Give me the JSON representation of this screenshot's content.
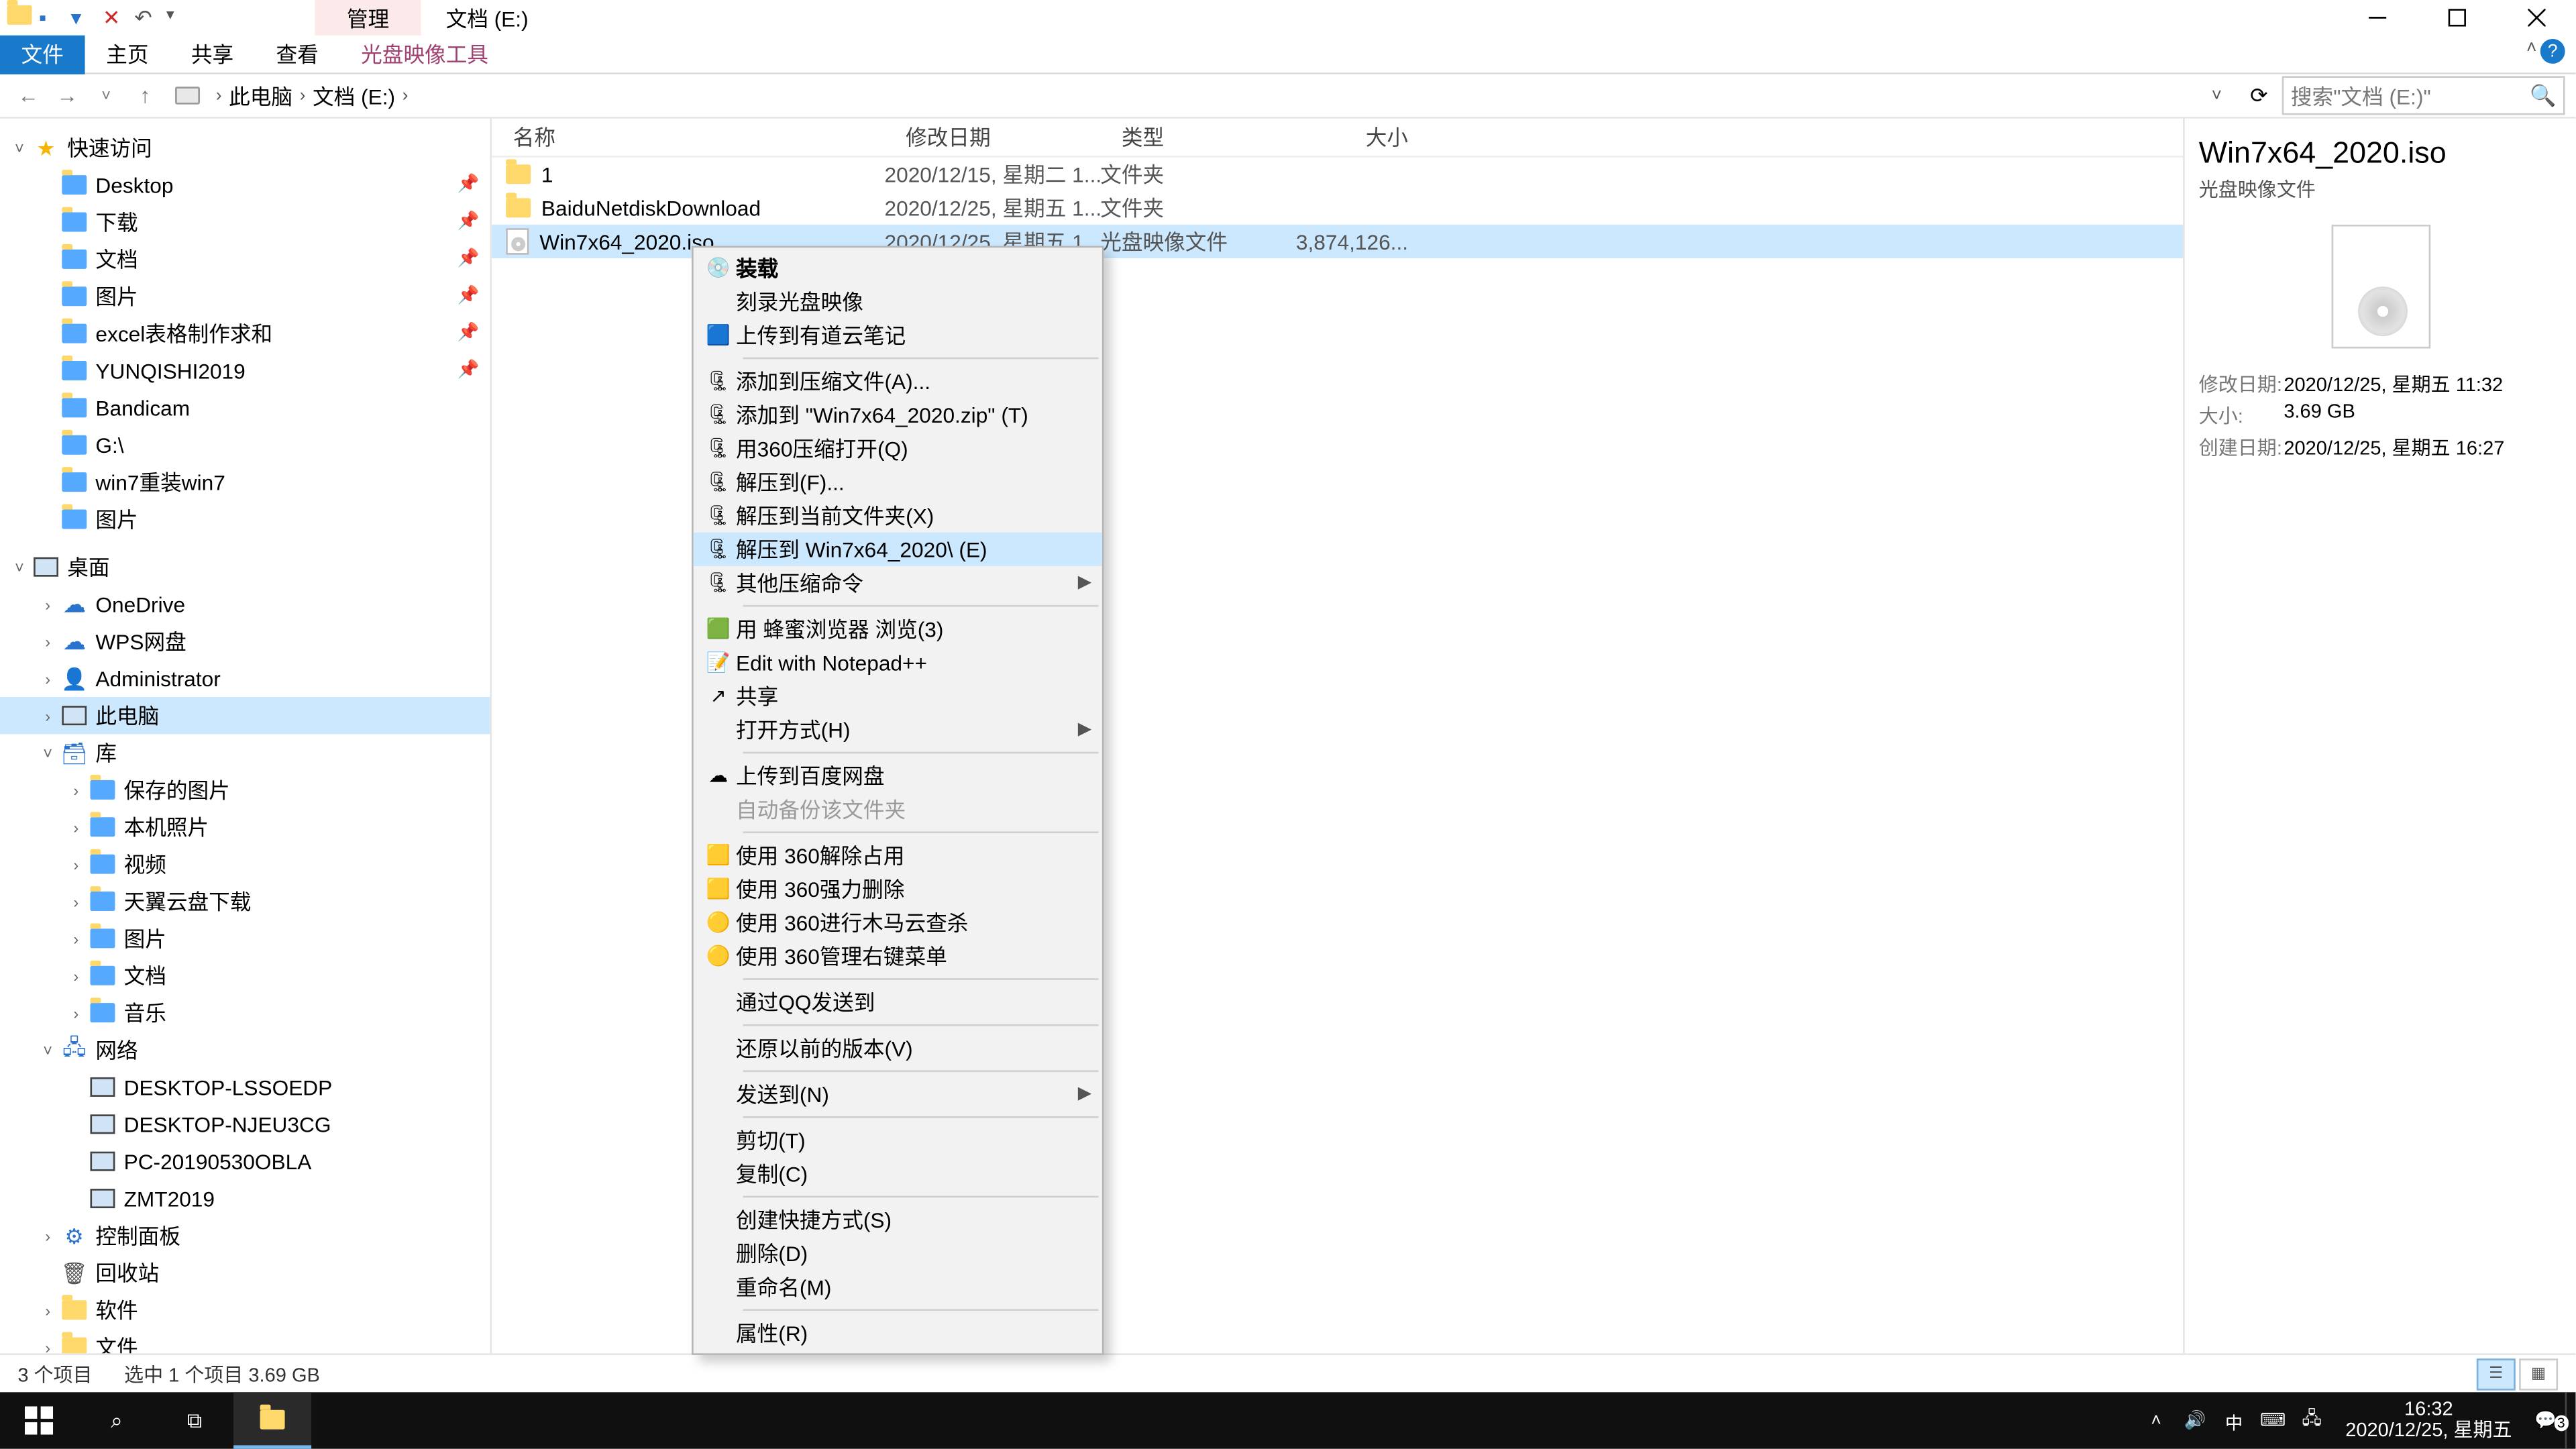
{
  "title_bar": {
    "manage_tab": "管理",
    "window_title": "文档 (E:)"
  },
  "ribbon": {
    "file": "文件",
    "home": "主页",
    "share": "共享",
    "view": "查看",
    "disc_tools": "光盘映像工具"
  },
  "address": {
    "root": "此电脑",
    "folder": "文档 (E:)"
  },
  "search": {
    "placeholder": "搜索\"文档 (E:)\""
  },
  "nav": {
    "quick": "快速访问",
    "items_q": [
      "Desktop",
      "下载",
      "文档",
      "图片",
      "excel表格制作求和",
      "YUNQISHI2019",
      "Bandicam",
      "G:\\",
      "win7重装win7",
      "图片"
    ],
    "desktop": "桌面",
    "onedrive": "OneDrive",
    "wps": "WPS网盘",
    "admin": "Administrator",
    "thispc": "此电脑",
    "libs": "库",
    "items_l": [
      "保存的图片",
      "本机照片",
      "视频",
      "天翼云盘下载",
      "图片",
      "文档",
      "音乐"
    ],
    "network": "网络",
    "items_n": [
      "DESKTOP-LSSOEDP",
      "DESKTOP-NJEU3CG",
      "PC-20190530OBLA",
      "ZMT2019"
    ],
    "cpanel": "控制面板",
    "recycle": "回收站",
    "soft": "软件",
    "files": "文件"
  },
  "columns": {
    "name": "名称",
    "date": "修改日期",
    "type": "类型",
    "size": "大小"
  },
  "rows": [
    {
      "name": "1",
      "date": "2020/12/15, 星期二 1...",
      "type": "文件夹",
      "size": "",
      "kind": "folder"
    },
    {
      "name": "BaiduNetdiskDownload",
      "date": "2020/12/25, 星期五 1...",
      "type": "文件夹",
      "size": "",
      "kind": "folder"
    },
    {
      "name": "Win7x64_2020.iso",
      "date": "2020/12/25, 星期五 1...",
      "type": "光盘映像文件",
      "size": "3,874,126...",
      "kind": "iso"
    }
  ],
  "context_menu": [
    {
      "t": "装载",
      "ic": "disc",
      "bold": true
    },
    {
      "t": "刻录光盘映像"
    },
    {
      "t": "上传到有道云笔记",
      "ic": "blue"
    },
    {
      "sep": true
    },
    {
      "t": "添加到压缩文件(A)...",
      "ic": "zip"
    },
    {
      "t": "添加到 \"Win7x64_2020.zip\" (T)",
      "ic": "zip"
    },
    {
      "t": "用360压缩打开(Q)",
      "ic": "zip"
    },
    {
      "t": "解压到(F)...",
      "ic": "zip"
    },
    {
      "t": "解压到当前文件夹(X)",
      "ic": "zip"
    },
    {
      "t": "解压到 Win7x64_2020\\ (E)",
      "ic": "zip",
      "hov": true
    },
    {
      "t": "其他压缩命令",
      "ic": "zip",
      "sub": true
    },
    {
      "sep": true
    },
    {
      "t": "用 蜂蜜浏览器 浏览(3)",
      "ic": "green"
    },
    {
      "t": "Edit with Notepad++",
      "ic": "npp"
    },
    {
      "t": "共享",
      "ic": "share"
    },
    {
      "t": "打开方式(H)",
      "sub": true
    },
    {
      "sep": true
    },
    {
      "t": "上传到百度网盘",
      "ic": "cloud"
    },
    {
      "t": "自动备份该文件夹",
      "dis": true
    },
    {
      "sep": true
    },
    {
      "t": "使用 360解除占用",
      "ic": "y"
    },
    {
      "t": "使用 360强力删除",
      "ic": "y"
    },
    {
      "t": "使用 360进行木马云查杀",
      "ic": "g360"
    },
    {
      "t": "使用 360管理右键菜单",
      "ic": "g360"
    },
    {
      "sep": true
    },
    {
      "t": "通过QQ发送到"
    },
    {
      "sep": true
    },
    {
      "t": "还原以前的版本(V)"
    },
    {
      "sep": true
    },
    {
      "t": "发送到(N)",
      "sub": true
    },
    {
      "sep": true
    },
    {
      "t": "剪切(T)"
    },
    {
      "t": "复制(C)"
    },
    {
      "sep": true
    },
    {
      "t": "创建快捷方式(S)"
    },
    {
      "t": "删除(D)"
    },
    {
      "t": "重命名(M)"
    },
    {
      "sep": true
    },
    {
      "t": "属性(R)"
    }
  ],
  "details": {
    "title": "Win7x64_2020.iso",
    "sub": "光盘映像文件",
    "k_mod": "修改日期:",
    "v_mod": "2020/12/25, 星期五 11:32",
    "k_size": "大小:",
    "v_size": "3.69 GB",
    "k_cre": "创建日期:",
    "v_cre": "2020/12/25, 星期五 16:27"
  },
  "status": {
    "count": "3 个项目",
    "sel": "选中 1 个项目  3.69 GB"
  },
  "taskbar": {
    "ime": "中",
    "time": "16:32",
    "date": "2020/12/25, 星期五",
    "notif": "3"
  }
}
